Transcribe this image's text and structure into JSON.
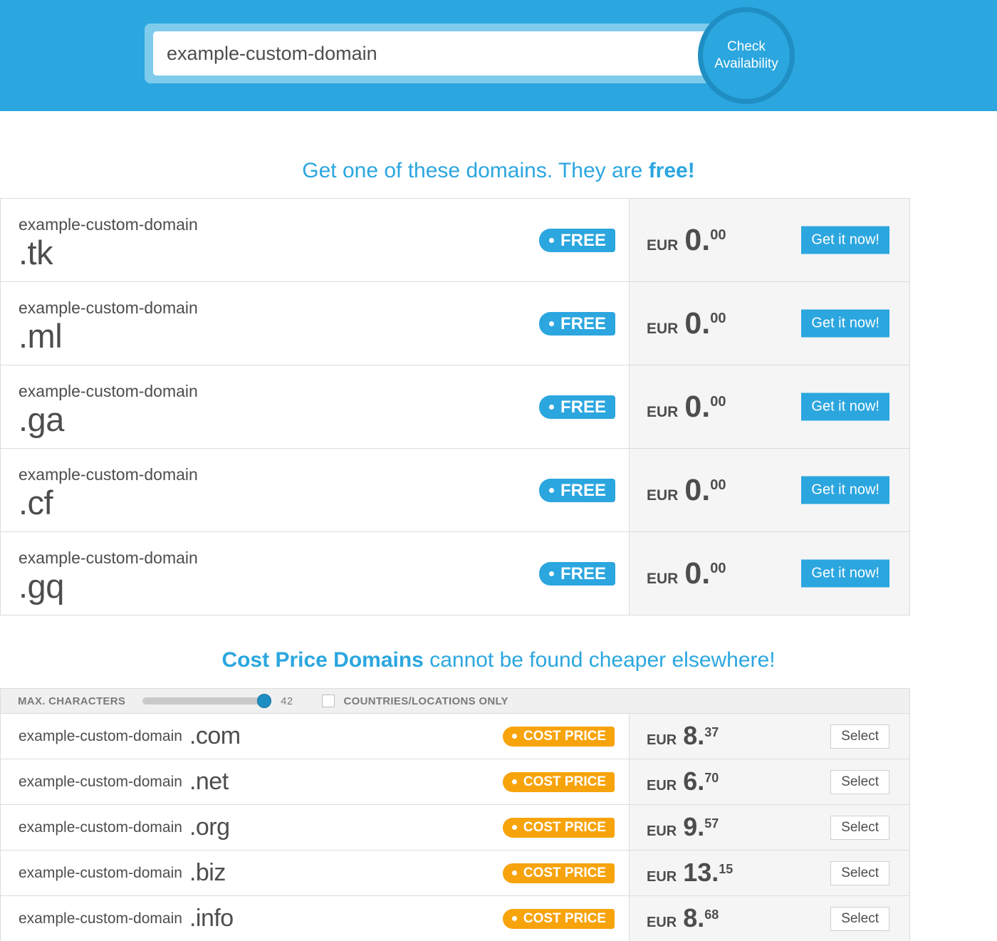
{
  "header": {
    "search_value": "example-custom-domain",
    "search_placeholder": "example-custom-domain",
    "check_button_line1": "Check",
    "check_button_line2": "Availability",
    "bar_color": "#2ba6df",
    "button_ring_color": "#1f8ec2"
  },
  "free_section": {
    "title_plain": "Get one of these domains. They are ",
    "title_bold": "free!",
    "badge_label": "FREE",
    "currency": "EUR",
    "action_label": "Get it now!",
    "accent_color": "#2ba6df",
    "rows": [
      {
        "domain": "example-custom-domain",
        "tld": ".tk",
        "badge": "FREE",
        "currency": "EUR",
        "price_whole": "0.",
        "price_frac": "00",
        "action": "Get it now!"
      },
      {
        "domain": "example-custom-domain",
        "tld": ".ml",
        "badge": "FREE",
        "currency": "EUR",
        "price_whole": "0.",
        "price_frac": "00",
        "action": "Get it now!"
      },
      {
        "domain": "example-custom-domain",
        "tld": ".ga",
        "badge": "FREE",
        "currency": "EUR",
        "price_whole": "0.",
        "price_frac": "00",
        "action": "Get it now!"
      },
      {
        "domain": "example-custom-domain",
        "tld": ".cf",
        "badge": "FREE",
        "currency": "EUR",
        "price_whole": "0.",
        "price_frac": "00",
        "action": "Get it now!"
      },
      {
        "domain": "example-custom-domain",
        "tld": ".gq",
        "badge": "FREE",
        "currency": "EUR",
        "price_whole": "0.",
        "price_frac": "00",
        "action": "Get it now!"
      }
    ]
  },
  "cost_section": {
    "title_bold": "Cost Price Domains",
    "title_plain": " cannot be found cheaper elsewhere!",
    "accent_color": "#f7a30b",
    "filters": {
      "max_characters_label": "MAX. CHARACTERS",
      "max_characters_value": "42",
      "countries_label": "COUNTRIES/LOCATIONS ONLY",
      "countries_checked": false
    },
    "rows": [
      {
        "domain": "example-custom-domain",
        "tld": ".com",
        "badge": "COST PRICE",
        "currency": "EUR",
        "price_whole": "8.",
        "price_frac": "37",
        "action": "Select"
      },
      {
        "domain": "example-custom-domain",
        "tld": ".net",
        "badge": "COST PRICE",
        "currency": "EUR",
        "price_whole": "6.",
        "price_frac": "70",
        "action": "Select"
      },
      {
        "domain": "example-custom-domain",
        "tld": ".org",
        "badge": "COST PRICE",
        "currency": "EUR",
        "price_whole": "9.",
        "price_frac": "57",
        "action": "Select"
      },
      {
        "domain": "example-custom-domain",
        "tld": ".biz",
        "badge": "COST PRICE",
        "currency": "EUR",
        "price_whole": "13.",
        "price_frac": "15",
        "action": "Select"
      },
      {
        "domain": "example-custom-domain",
        "tld": ".info",
        "badge": "COST PRICE",
        "currency": "EUR",
        "price_whole": "8.",
        "price_frac": "68",
        "action": "Select"
      }
    ]
  }
}
